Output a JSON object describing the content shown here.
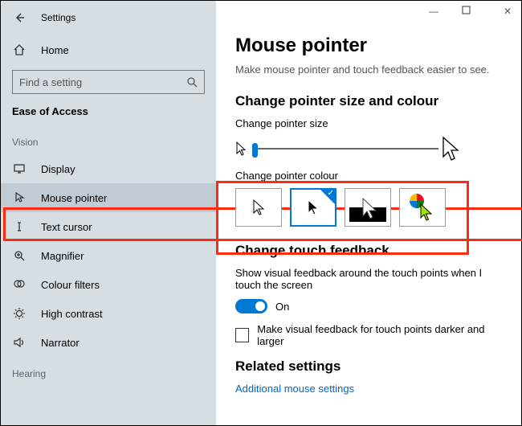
{
  "window": {
    "title": "Settings",
    "minimize": "—",
    "maximize": "▢",
    "close": "✕"
  },
  "sidebar": {
    "home_label": "Home",
    "search_placeholder": "Find a setting",
    "section_title": "Ease of Access",
    "group_vision": "Vision",
    "group_hearing": "Hearing",
    "items": [
      {
        "label": "Display"
      },
      {
        "label": "Mouse pointer"
      },
      {
        "label": "Text cursor"
      },
      {
        "label": "Magnifier"
      },
      {
        "label": "Colour filters"
      },
      {
        "label": "High contrast"
      },
      {
        "label": "Narrator"
      }
    ]
  },
  "main": {
    "title": "Mouse pointer",
    "subtitle": "Make mouse pointer and touch feedback easier to see.",
    "size_colour_heading": "Change pointer size and colour",
    "size_label": "Change pointer size",
    "colour_label": "Change pointer colour",
    "touch_heading": "Change touch feedback",
    "touch_desc": "Show visual feedback around the touch points when I touch the screen",
    "toggle_state": "On",
    "checkbox_label": "Make visual feedback for touch points darker and larger",
    "related_heading": "Related settings",
    "related_link": "Additional mouse settings"
  }
}
